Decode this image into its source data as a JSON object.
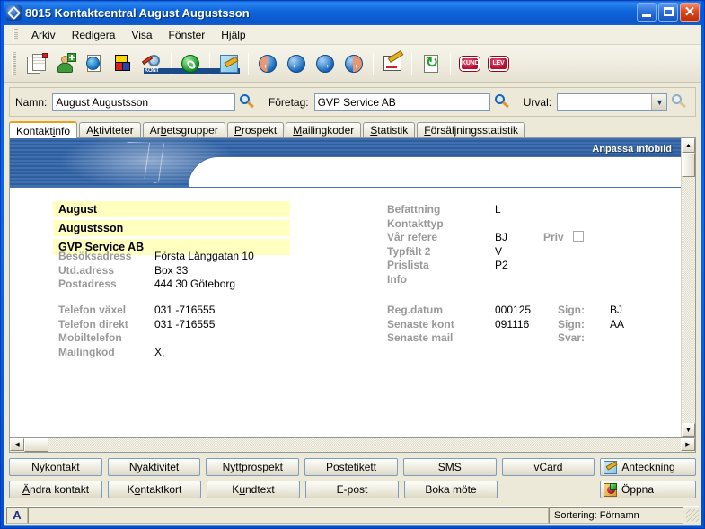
{
  "window": {
    "title": "8015 Kontaktcentral August Augustsson",
    "icon": "app-diamond-icon",
    "controls": {
      "minimize": "_",
      "maximize": "□",
      "close": "✕"
    }
  },
  "menu": [
    {
      "label": "Arkiv",
      "accel": "A"
    },
    {
      "label": "Redigera",
      "accel": "R"
    },
    {
      "label": "Visa",
      "accel": "V"
    },
    {
      "label": "Fönster",
      "accel": "ö"
    },
    {
      "label": "Hjälp",
      "accel": "H"
    }
  ],
  "toolbar": {
    "buttons": [
      {
        "name": "new-contact-doc-icon"
      },
      {
        "name": "add-person-icon"
      },
      {
        "name": "web-document-icon"
      },
      {
        "name": "color-blocks-icon"
      },
      {
        "name": "kont-search-icon",
        "text": "KONT"
      },
      {
        "name": "phone-call-icon"
      },
      {
        "name": "note-edit-icon"
      },
      {
        "name": "first-record-icon",
        "glyph": "←"
      },
      {
        "name": "previous-record-icon",
        "glyph": "←"
      },
      {
        "name": "next-record-icon",
        "glyph": "→"
      },
      {
        "name": "last-record-icon",
        "glyph": "→"
      },
      {
        "name": "sign-document-icon"
      },
      {
        "name": "refresh-icon"
      },
      {
        "name": "kund-icon",
        "text": "KUND"
      },
      {
        "name": "lev-icon",
        "text": "LEV"
      }
    ]
  },
  "search": {
    "namn_label": "Namn:",
    "namn_value": "August Augustsson",
    "foretag_label": "Företag:",
    "foretag_value": "GVP Service AB",
    "urval_label": "Urval:",
    "urval_value": ""
  },
  "tabs": [
    {
      "label": "Kontaktinfo",
      "active": true
    },
    {
      "label": "Aktiviteter",
      "active": false
    },
    {
      "label": "Arbetsgrupper",
      "active": false
    },
    {
      "label": "Prospekt",
      "active": false
    },
    {
      "label": "Mailingkoder",
      "active": false
    },
    {
      "label": "Statistik",
      "active": false
    },
    {
      "label": "Försäljningsstatistik",
      "active": false
    }
  ],
  "panel": {
    "banner_link": "Anpassa infobild",
    "highlights": [
      "August",
      "Augustsson",
      "GVP Service AB"
    ],
    "address": [
      {
        "label": "Besöksadress",
        "value": "Första Långgatan 10"
      },
      {
        "label": "Utd.adress",
        "value": "Box 33"
      },
      {
        "label": "Postadress",
        "value": "444 30 Göteborg"
      }
    ],
    "phones": [
      {
        "label": "Telefon växel",
        "value": "031 -716555"
      },
      {
        "label": "Telefon direkt",
        "value": "031 -716555"
      },
      {
        "label": "Mobiltelefon",
        "value": ""
      },
      {
        "label": "Mailingkod",
        "value": "X,"
      }
    ],
    "details": [
      {
        "label": "Befattning",
        "value": "L"
      },
      {
        "label": "Kontakttyp",
        "value": ""
      },
      {
        "label": "Vår refere",
        "value": "BJ"
      },
      {
        "label": "Typfält 2",
        "value": "V"
      },
      {
        "label": "Prislista",
        "value": "P2"
      },
      {
        "label": "Info",
        "value": ""
      }
    ],
    "priv_label": "Priv",
    "priv_checked": false,
    "dates": [
      {
        "label": "Reg.datum",
        "value": "000125",
        "sub_label": "Sign:",
        "sub_value": "BJ"
      },
      {
        "label": "Senaste kont",
        "value": "091116",
        "sub_label": "Sign:",
        "sub_value": "AA"
      },
      {
        "label": "Senaste mail",
        "value": "",
        "sub_label": "Svar:",
        "sub_value": ""
      }
    ]
  },
  "buttons": {
    "row1": [
      {
        "label": "Ny kontakt",
        "accel": "y"
      },
      {
        "label": "Ny aktivitet",
        "accel": "y"
      },
      {
        "label": "Nytt prospekt",
        "accel": "tt"
      },
      {
        "label": "Postetikett",
        "accel": "e"
      },
      {
        "label": "SMS",
        "accel": ""
      },
      {
        "label": "vCard",
        "accel": "C"
      }
    ],
    "row2": [
      {
        "label": "Ändra kontakt",
        "accel": "Ä"
      },
      {
        "label": "Kontaktkort",
        "accel": "o"
      },
      {
        "label": "Kundtext",
        "accel": "u"
      },
      {
        "label": "E-post",
        "accel": ""
      },
      {
        "label": "Boka möte",
        "accel": ""
      }
    ],
    "side": [
      {
        "label": "Anteckning",
        "icon": "note-icon"
      },
      {
        "label": "Öppna",
        "icon": "open-folder-icon"
      }
    ]
  },
  "statusbar": {
    "left_icon": "A",
    "message": "",
    "sorting": "Sortering: Förnamn"
  },
  "colors": {
    "title_blue": "#0a56c8",
    "client_bg": "#ece9d8",
    "highlight_yellow": "#ffffc0",
    "label_gray": "#999999",
    "banner_blue": "#3f6fae",
    "button_border": "#7b9cc4",
    "active_tab_accent": "#e8a020"
  }
}
